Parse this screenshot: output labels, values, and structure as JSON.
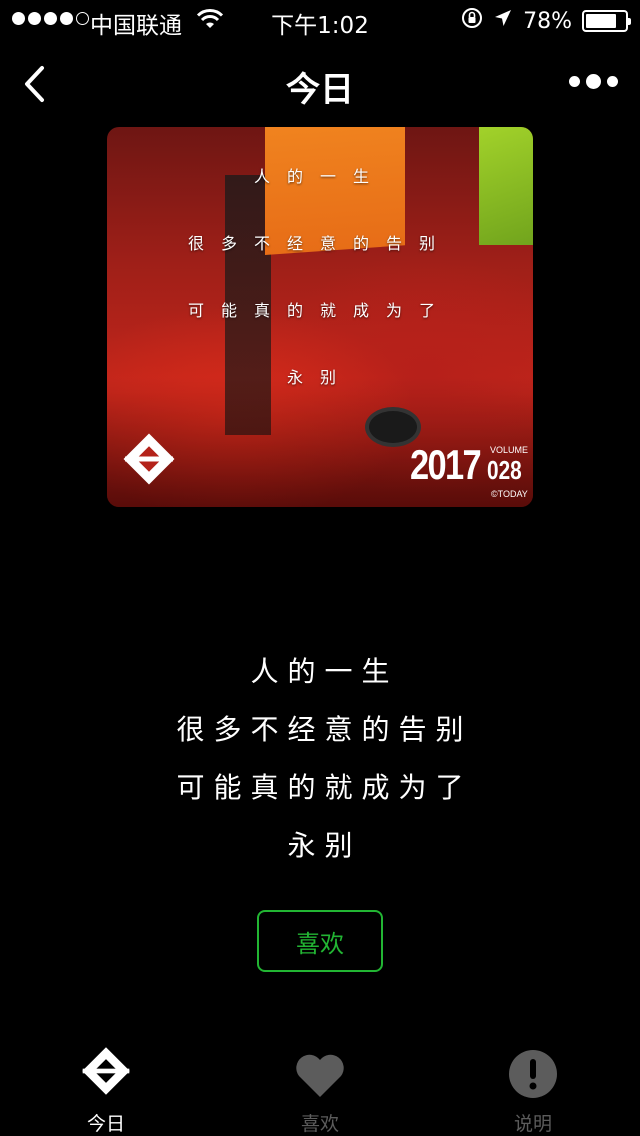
{
  "status_bar": {
    "carrier": "中国联通",
    "time": "下午1:02",
    "battery_percent": "78%",
    "battery_level": 0.78,
    "signal_bars": 4
  },
  "nav": {
    "title": "今日",
    "back_icon": "chevron-left-icon",
    "more_icon": "more-dots-icon"
  },
  "cover": {
    "lines": [
      "人的一生",
      "很多不经意的告别",
      "可能真的就成为了",
      "永别"
    ],
    "year": "2017",
    "volume_label": "VOLUME",
    "volume_number": "028",
    "copyright": "©TODAY",
    "logo_icon": "today-logo-icon"
  },
  "quote": {
    "lines": [
      "人的一生",
      "很多不经意的告别",
      "可能真的就成为了",
      "永别"
    ]
  },
  "like_button": {
    "label": "喜欢",
    "color": "#22b533"
  },
  "tabs": [
    {
      "label": "今日",
      "icon": "today-logo-icon",
      "active": true
    },
    {
      "label": "喜欢",
      "icon": "heart-icon",
      "active": false
    },
    {
      "label": "说明",
      "icon": "info-exclamation-icon",
      "active": false
    }
  ]
}
